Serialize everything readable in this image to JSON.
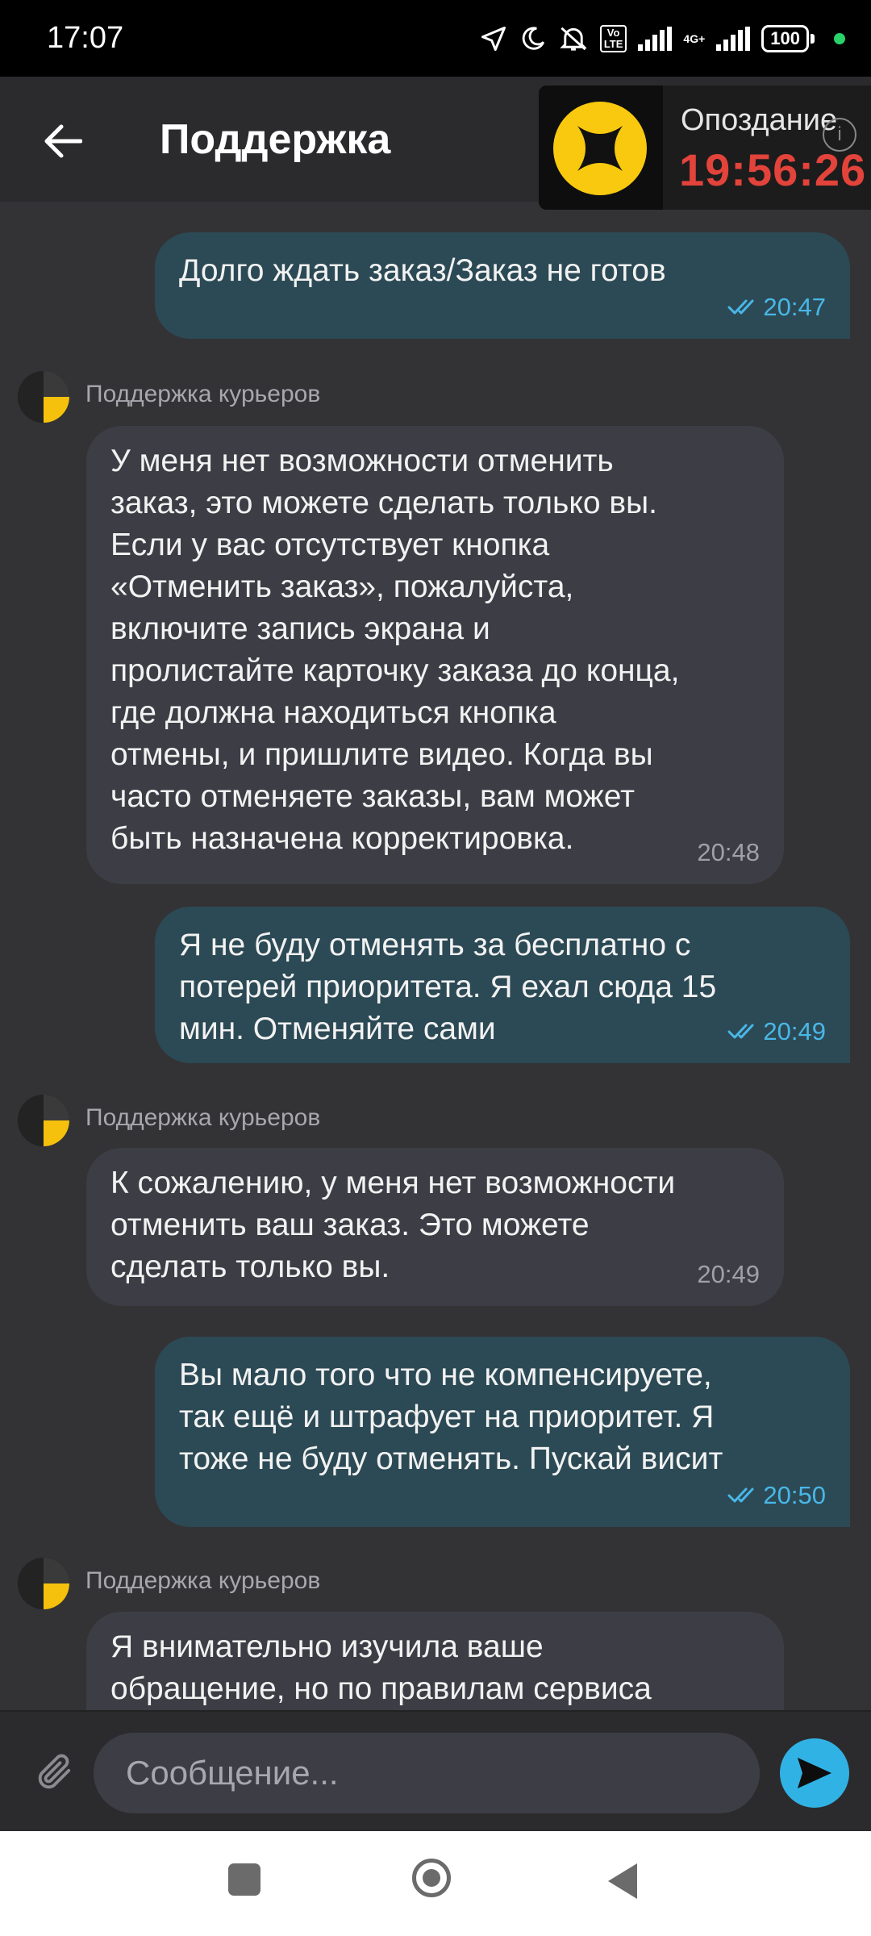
{
  "status_bar": {
    "time": "17:07",
    "lte_top": "Vo",
    "lte_bottom": "LTE",
    "net_label": "4G+",
    "battery": "100",
    "dot_color": "#28d36a"
  },
  "header": {
    "title": "Поддержка"
  },
  "overlay": {
    "label": "Опоздание",
    "timer": "19:56:26",
    "timer_color": "#e2433a",
    "logo_color": "#f8c90e"
  },
  "messages": [
    {
      "direction": "out",
      "text": "Долго ждать заказ/Заказ не готов",
      "time": "20:47",
      "read": true
    },
    {
      "direction": "in",
      "sender": "Поддержка курьеров",
      "text": "У меня нет возможности отменить\nзаказ, это можете сделать только вы.\nЕсли у вас отсутствует кнопка\n«Отменить заказ», пожалуйста,\nвключите запись экрана и\nпролистайте карточку заказа до конца,\nгде должна находиться кнопка\nотмены, и пришлите видео. Когда вы\nчасто отменяете заказы, вам может\nбыть назначена корректировка.",
      "time": "20:48"
    },
    {
      "direction": "out",
      "text": "Я не буду отменять за бесплатно с\nпотерей приоритета. Я ехал сюда 15\nмин. Отменяйте сами",
      "time": "20:49",
      "read": true
    },
    {
      "direction": "in",
      "sender": "Поддержка курьеров",
      "text": "К сожалению, у меня нет возможности\nотменить ваш заказ. Это можете\nсделать только вы.",
      "time": "20:49"
    },
    {
      "direction": "out",
      "text": "Вы мало того что не компенсируете,\nтак ещё и штрафует на приоритет. Я\nтоже не буду отменять. Пускай висит",
      "time": "20:50",
      "read": true
    },
    {
      "direction": "in",
      "sender": "Поддержка курьеров",
      "text": "Я внимательно изучила ваше\nобращение, но по правилам сервиса",
      "time": ""
    }
  ],
  "composer": {
    "placeholder": "Сообщение..."
  },
  "colors": {
    "background": "#333336",
    "outgoing_bubble": "#2c4a55",
    "incoming_bubble": "#3d3d46",
    "read_check": "#49b7e8",
    "send_button": "#31b2e4"
  }
}
